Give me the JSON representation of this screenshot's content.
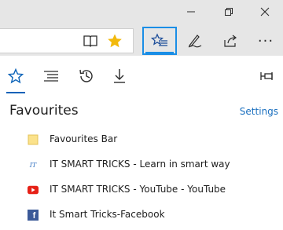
{
  "toolbar": {
    "buttons": [
      {
        "name": "hub",
        "icon": "favorites-hub-icon",
        "active": true
      },
      {
        "name": "notes",
        "icon": "pen-icon"
      },
      {
        "name": "share",
        "icon": "share-icon"
      },
      {
        "name": "more",
        "icon": "more-icon",
        "label": "···"
      }
    ]
  },
  "address_bar": {
    "reading_view_icon": "book-icon",
    "favorite_star_icon": "star-icon",
    "star_color": "#f2b90c"
  },
  "hub": {
    "tabs": [
      {
        "name": "favourites",
        "icon": "star-icon",
        "selected": true
      },
      {
        "name": "reading-list",
        "icon": "reading-list-icon"
      },
      {
        "name": "history",
        "icon": "history-icon"
      },
      {
        "name": "downloads",
        "icon": "download-icon"
      }
    ],
    "pin_icon": "pin-icon",
    "title": "Favourites",
    "settings_label": "Settings",
    "items": [
      {
        "label": "Favourites Bar",
        "icon": "folder-icon"
      },
      {
        "label": "IT SMART TRICKS - Learn in smart way",
        "icon": "site-favicon-icon",
        "icon_text": "IT"
      },
      {
        "label": "IT SMART TRICKS - YouTube - YouTube",
        "icon": "youtube-icon"
      },
      {
        "label": "It Smart Tricks-Facebook",
        "icon": "facebook-icon",
        "icon_text": "f"
      }
    ]
  },
  "colors": {
    "accent": "#1a8ee6",
    "link": "#1a6fbf",
    "chrome": "#e6e6e6",
    "youtube": "#e62117",
    "facebook": "#3b5998",
    "folder": "#fbe28b"
  }
}
